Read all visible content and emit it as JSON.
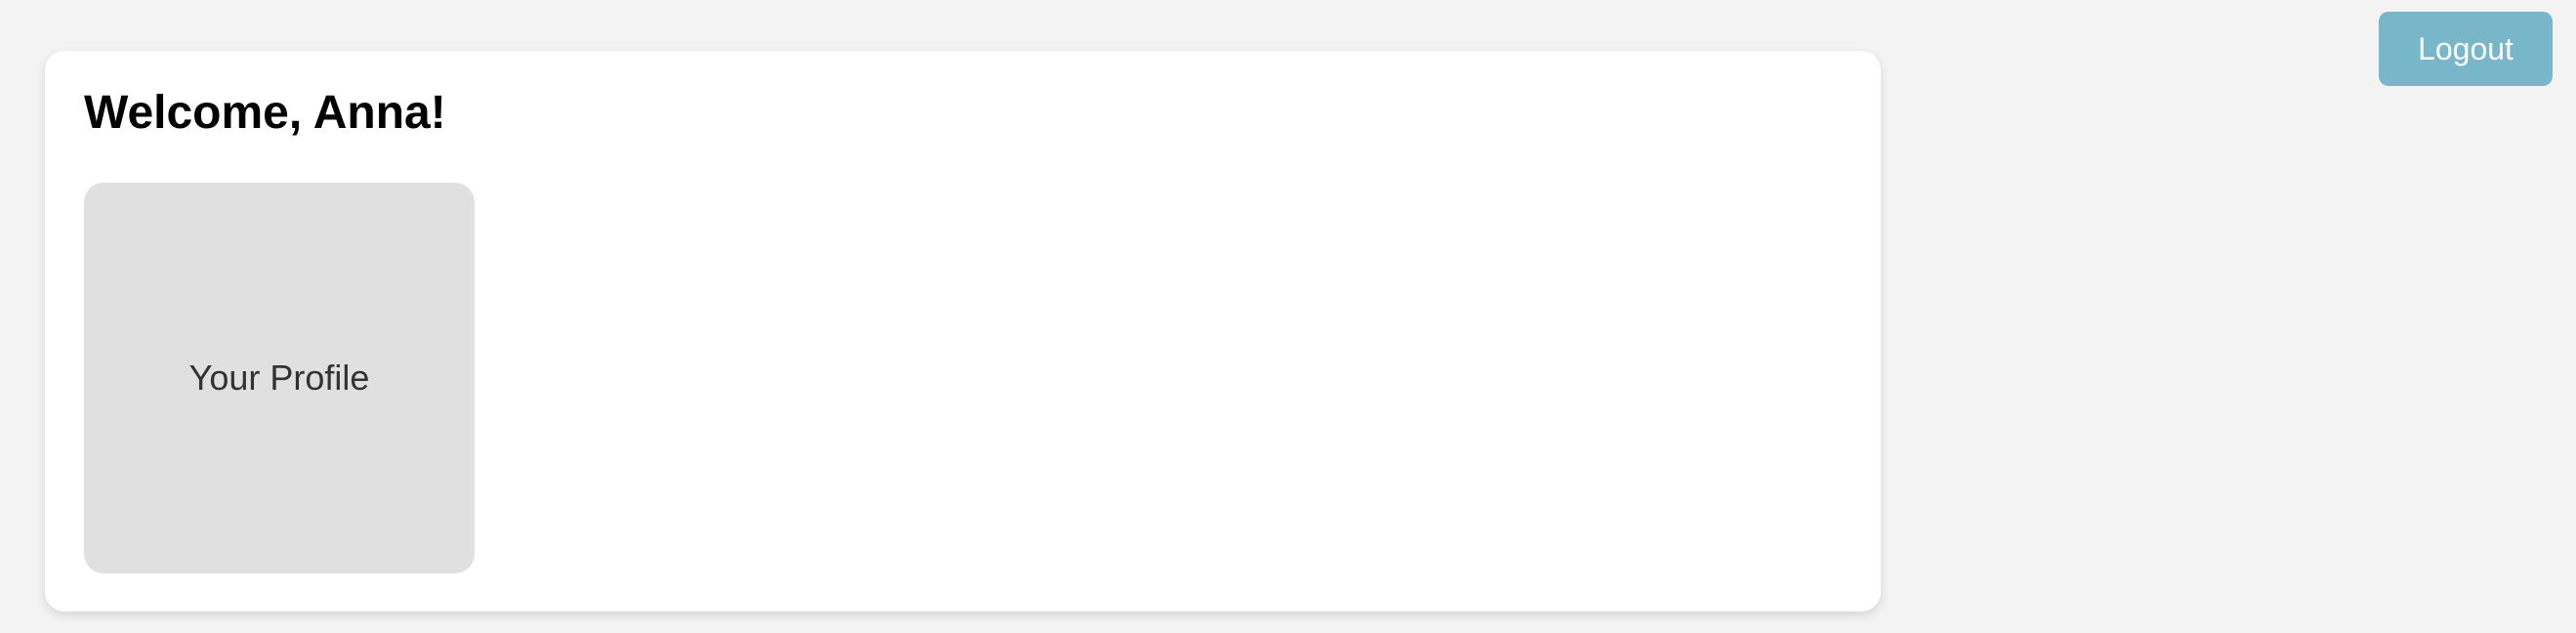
{
  "header": {
    "logout_label": "Logout"
  },
  "main": {
    "title": "Welcome, Anna!",
    "tiles": [
      {
        "label": "Your Profile"
      }
    ]
  },
  "colors": {
    "background": "#f3f3f3",
    "card": "#ffffff",
    "logout_button": "#78b7ca",
    "tile": "#e0e0e0"
  }
}
